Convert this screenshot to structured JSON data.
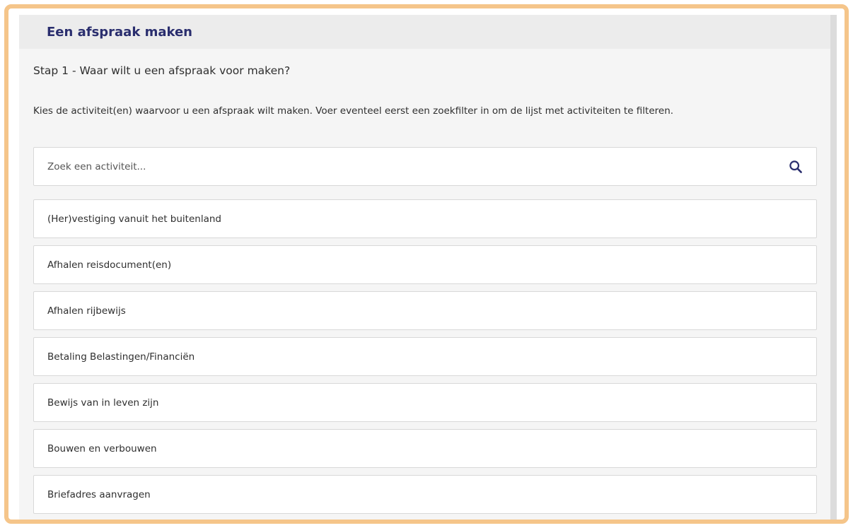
{
  "header": {
    "title": "Een afspraak maken"
  },
  "step": {
    "title": "Stap 1 - Waar wilt u een afspraak voor maken?",
    "instruction": "Kies de activiteit(en) waarvoor u een afspraak wilt maken. Voer eventeel eerst een zoekfilter in om de lijst met activiteiten te filteren."
  },
  "search": {
    "placeholder": "Zoek een activiteit...",
    "value": "",
    "icon": "search-icon"
  },
  "activities": [
    "(Her)vestiging vanuit het buitenland",
    "Afhalen reisdocument(en)",
    "Afhalen rijbewijs",
    "Betaling Belastingen/Financiën",
    "Bewijs van in leven zijn",
    "Bouwen en verbouwen",
    "Briefadres aanvragen"
  ],
  "colors": {
    "frame_border": "#f5c58a",
    "title": "#2a2e6e",
    "panel_background": "#f5f5f5",
    "header_background": "#ececec"
  }
}
